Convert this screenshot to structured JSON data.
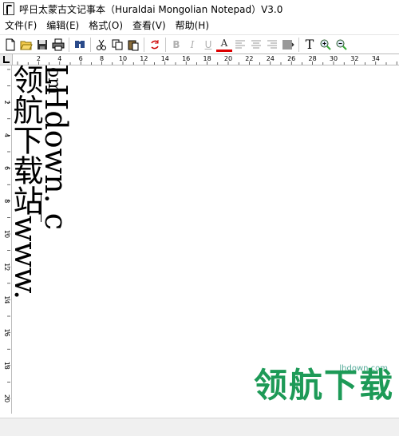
{
  "window": {
    "title": "呼日太蒙古文记事本（Huraldai Mongolian Notepad）V3.0"
  },
  "menu": {
    "items": [
      "文件(F)",
      "编辑(E)",
      "格式(O)",
      "查看(V)",
      "帮助(H)"
    ]
  },
  "toolbar": {
    "icons": [
      "new-file-icon",
      "open-folder-icon",
      "save-icon",
      "print-icon",
      "find-icon",
      "cut-icon",
      "copy-icon",
      "paste-icon",
      "rotate-icon",
      "bold-icon",
      "italic-icon",
      "underline-icon",
      "font-color-icon",
      "align-left-icon",
      "align-center-icon",
      "align-right-icon",
      "justify-icon",
      "text-icon",
      "zoom-in-icon",
      "zoom-out-icon"
    ],
    "text_icon_label": "T",
    "bold_label": "B",
    "italic_label": "I",
    "underline_label": "U",
    "font_color_label": "A"
  },
  "ruler": {
    "labels": [
      "2",
      "4",
      "6",
      "8",
      "10",
      "12",
      "14",
      "16",
      "18",
      "20",
      "22",
      "24",
      "26",
      "28",
      "30",
      "32",
      "34"
    ]
  },
  "vruler": {
    "labels": [
      "2",
      "4",
      "6",
      "8",
      "10",
      "12",
      "14",
      "16",
      "18",
      "20"
    ]
  },
  "document": {
    "col1_prefix": "om",
    "col2_text": "领航下载站www. LHdown. c"
  },
  "watermark": {
    "text": "领航下载",
    "site": "lhdown.com"
  }
}
